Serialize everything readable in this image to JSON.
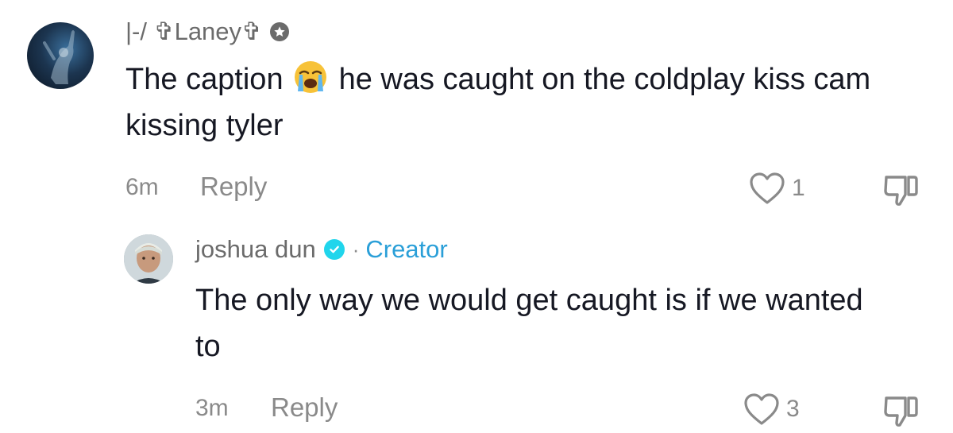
{
  "comments": [
    {
      "username": "|-/ ✞Laney✞",
      "badge_icon": "star-badge-icon",
      "text_before_emoji": "The caption",
      "emoji": "loudly-crying-face-emoji",
      "text_after_emoji": "he was caught on the coldplay kiss cam kissing tyler",
      "time": "6m",
      "reply_label": "Reply",
      "like_count": "1",
      "reply": {
        "username": "joshua dun",
        "verified": true,
        "separator": "·",
        "role_label": "Creator",
        "text": "The only way we would get caught is if we wanted to",
        "time": "3m",
        "reply_label": "Reply",
        "like_count": "3"
      }
    }
  ],
  "colors": {
    "text_primary": "#161823",
    "text_secondary": "#8a8a8a",
    "creator_blue": "#2a9fd8",
    "verified_cyan": "#20d5ec"
  }
}
